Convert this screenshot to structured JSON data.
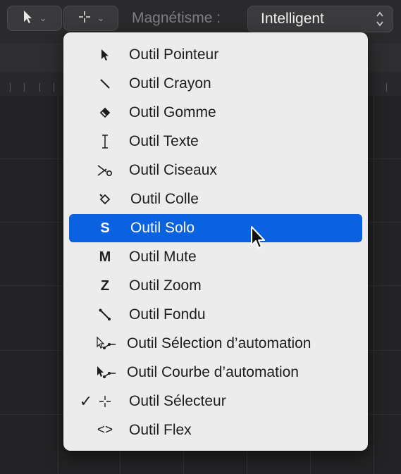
{
  "toolbar": {
    "left_tool_icon": "arrow-pointer-icon",
    "right_tool_icon": "crosshair-icon",
    "magnetism_label": "Magnétisme :",
    "magnetism_value": "Intelligent"
  },
  "menu": {
    "items": [
      {
        "label": "Outil Pointeur",
        "icon": "arrow-pointer-icon",
        "checked": false,
        "selected": false
      },
      {
        "label": "Outil Crayon",
        "icon": "pencil-icon",
        "checked": false,
        "selected": false
      },
      {
        "label": "Outil Gomme",
        "icon": "eraser-icon",
        "checked": false,
        "selected": false
      },
      {
        "label": "Outil Texte",
        "icon": "text-cursor-icon",
        "checked": false,
        "selected": false
      },
      {
        "label": "Outil Ciseaux",
        "icon": "scissors-icon",
        "checked": false,
        "selected": false
      },
      {
        "label": "Outil Colle",
        "icon": "glue-icon",
        "checked": false,
        "selected": false
      },
      {
        "label": "Outil Solo",
        "icon": "S",
        "checked": false,
        "selected": true
      },
      {
        "label": "Outil Mute",
        "icon": "M",
        "checked": false,
        "selected": false
      },
      {
        "label": "Outil Zoom",
        "icon": "Z",
        "checked": false,
        "selected": false
      },
      {
        "label": "Outil Fondu",
        "icon": "fade-icon",
        "checked": false,
        "selected": false
      },
      {
        "label": "Outil Sélection d’automation",
        "icon": "automation-select-icon",
        "checked": false,
        "selected": false
      },
      {
        "label": "Outil Courbe d’automation",
        "icon": "automation-curve-icon",
        "checked": false,
        "selected": false
      },
      {
        "label": "Outil Sélecteur",
        "icon": "crosshair-icon",
        "checked": true,
        "selected": false
      },
      {
        "label": "Outil Flex",
        "icon": "flex-icon",
        "checked": false,
        "selected": false
      }
    ],
    "check_glyph": "✓",
    "letter_icons": {
      "solo": "S",
      "mute": "M",
      "zoom": "Z"
    },
    "flex_glyph": "<>"
  },
  "colors": {
    "selection": "#0a62e0",
    "menu_bg": "#ececec"
  }
}
